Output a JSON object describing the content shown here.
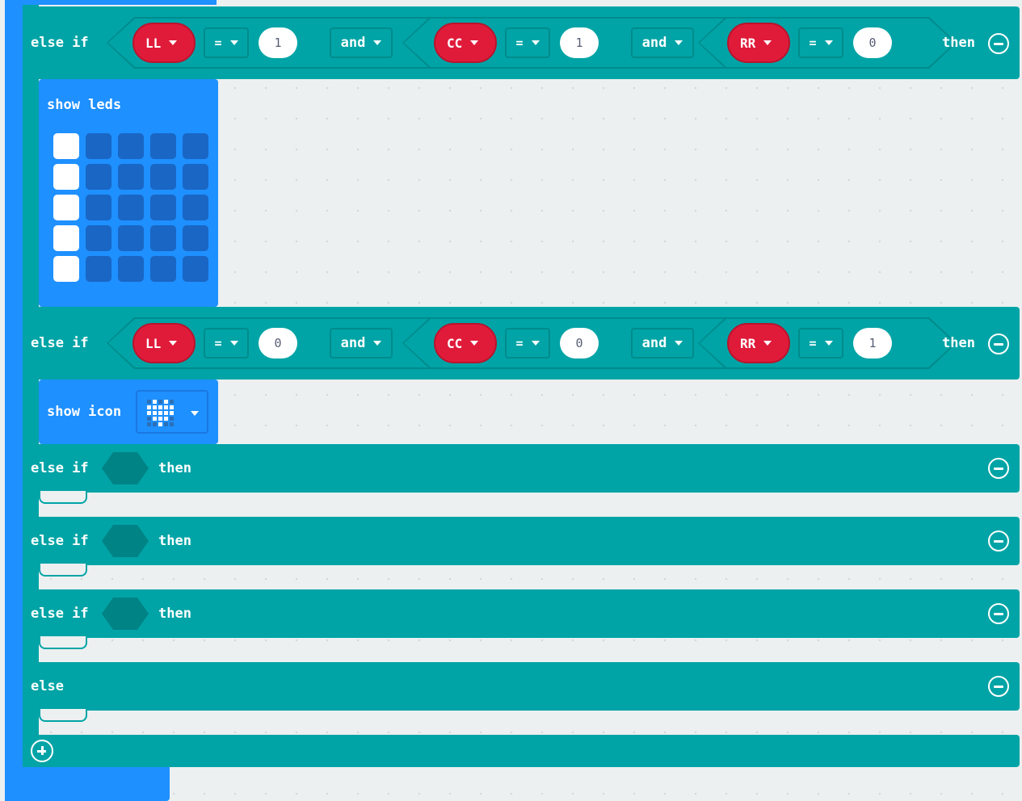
{
  "keywords": {
    "else_if": "else if",
    "then": "then",
    "else": "else",
    "and": "and"
  },
  "condition_rows": [
    {
      "vars": [
        "LL",
        "CC",
        "RR"
      ],
      "operators": [
        "=",
        "=",
        "="
      ],
      "values": [
        "1",
        "1",
        "0"
      ]
    },
    {
      "vars": [
        "LL",
        "CC",
        "RR"
      ],
      "operators": [
        "=",
        "=",
        "="
      ],
      "values": [
        "0",
        "0",
        "1"
      ]
    }
  ],
  "show_leds": {
    "label": "show leds",
    "grid": [
      [
        1,
        0,
        0,
        0,
        0
      ],
      [
        1,
        0,
        0,
        0,
        0
      ],
      [
        1,
        0,
        0,
        0,
        0
      ],
      [
        1,
        0,
        0,
        0,
        0
      ],
      [
        1,
        0,
        0,
        0,
        0
      ]
    ]
  },
  "show_icon": {
    "label": "show icon",
    "icon": "heart-icon",
    "grid": [
      [
        0,
        1,
        0,
        1,
        0
      ],
      [
        1,
        1,
        1,
        1,
        1
      ],
      [
        1,
        1,
        1,
        1,
        1
      ],
      [
        0,
        1,
        1,
        1,
        0
      ],
      [
        0,
        0,
        1,
        0,
        0
      ]
    ]
  },
  "empty_else_if_count": 3,
  "colors": {
    "logic": "#00a4a6",
    "logic_dark": "#008b8d",
    "variable": "#e01b3a",
    "basic": "#1e90ff",
    "workspace": "#ecf0f1"
  }
}
